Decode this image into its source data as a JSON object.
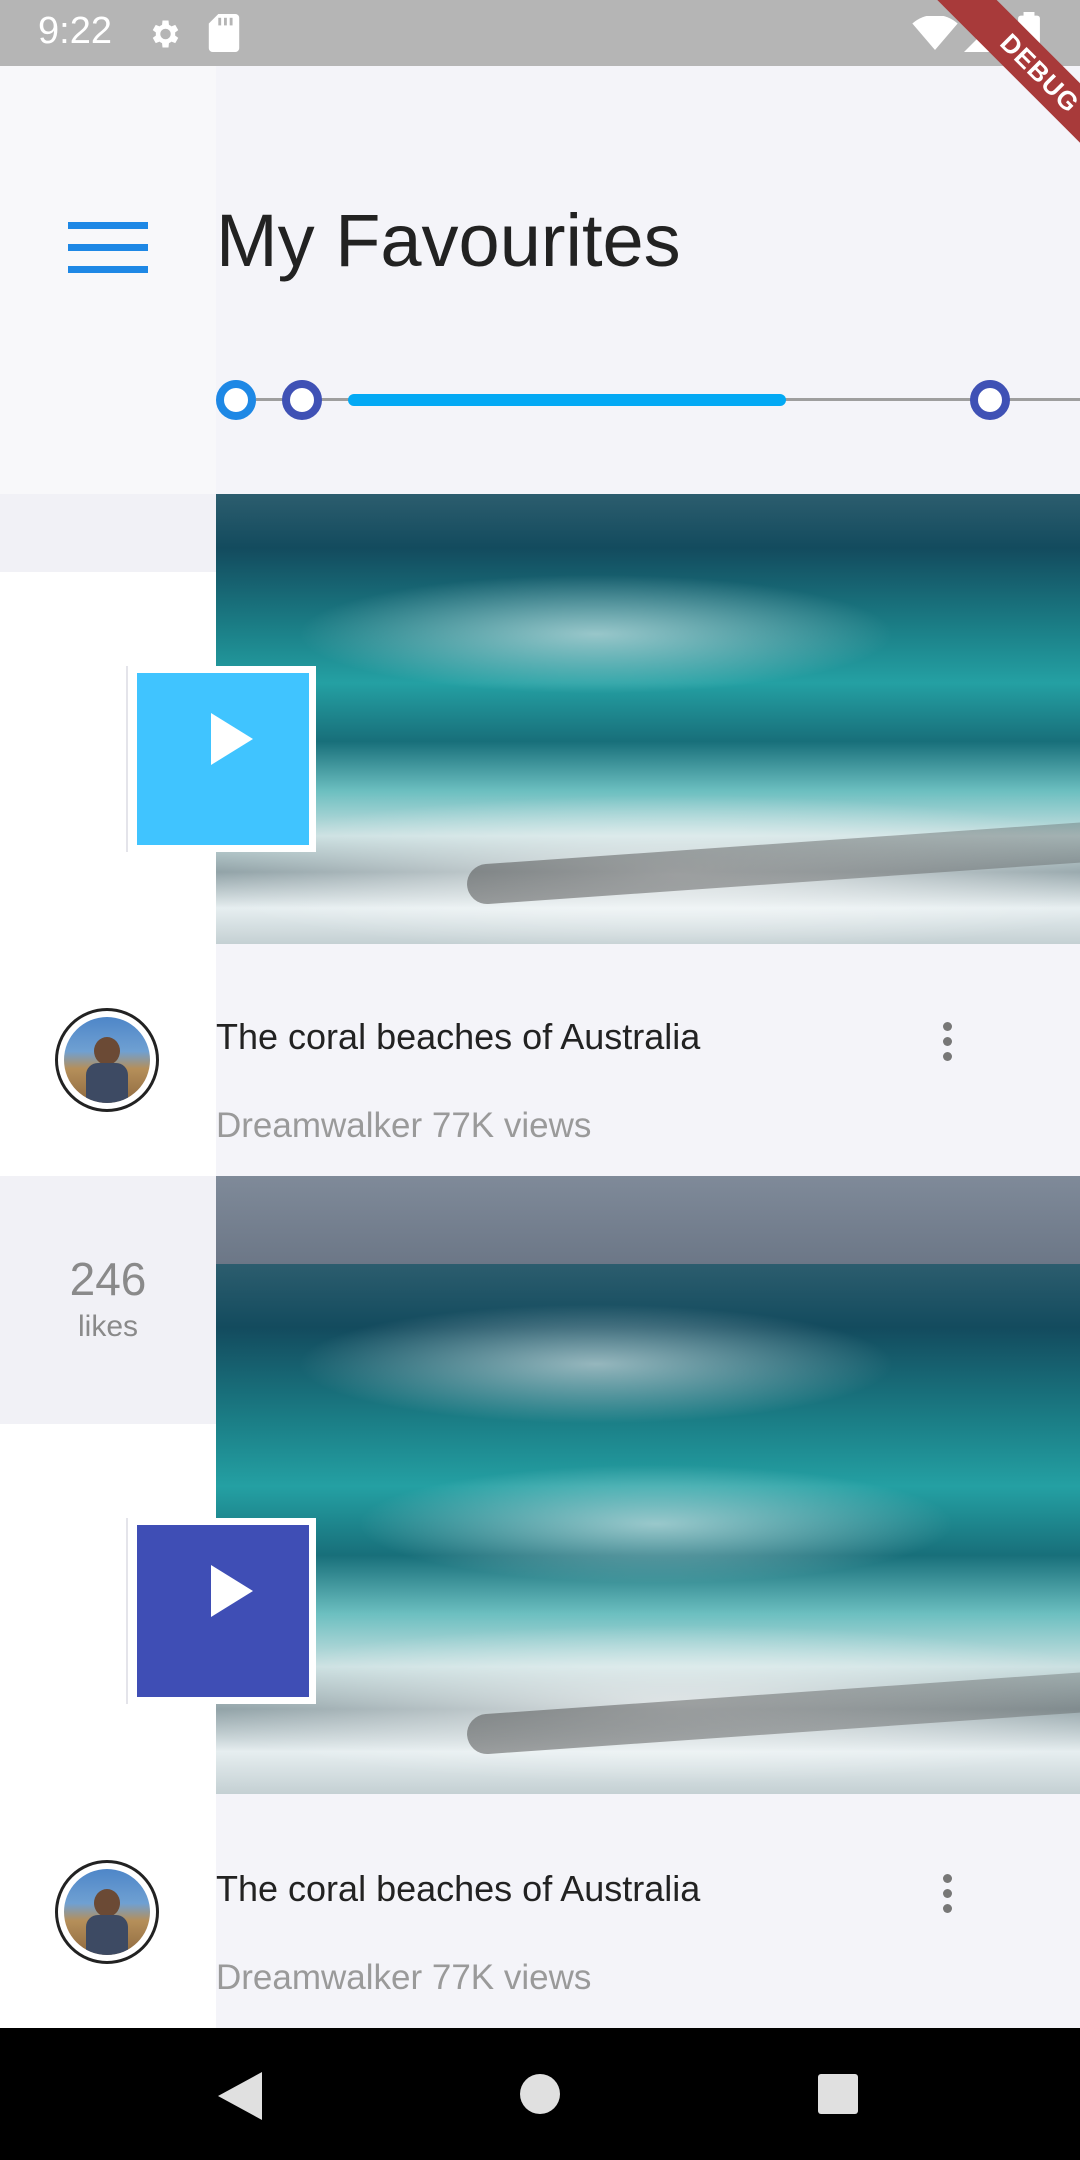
{
  "status_bar": {
    "time": "9:22",
    "icons": [
      "gear-icon",
      "sd-card-icon",
      "wifi-icon",
      "signal-icon",
      "battery-icon"
    ],
    "debug_label": "DEBUG"
  },
  "header": {
    "title": "My Favourites",
    "menu_icon": "hamburger-menu-icon"
  },
  "timeline": {
    "progress": 0.5,
    "colors": {
      "accent": "#03a9f4",
      "node_first": "#1e88e5",
      "node_other": "#3f51b5"
    }
  },
  "items": [
    {
      "title": "The coral beaches of Australia",
      "meta": "Dreamwalker 77K views",
      "play_color": "#40c4ff"
    },
    {
      "title": "The coral beaches of Australia",
      "meta": "Dreamwalker 77K views",
      "play_color": "#3f4eb5"
    }
  ],
  "likes": {
    "count": "246",
    "label": "likes"
  },
  "navbar": {
    "icons": [
      "back-icon",
      "home-icon",
      "recents-icon"
    ]
  }
}
